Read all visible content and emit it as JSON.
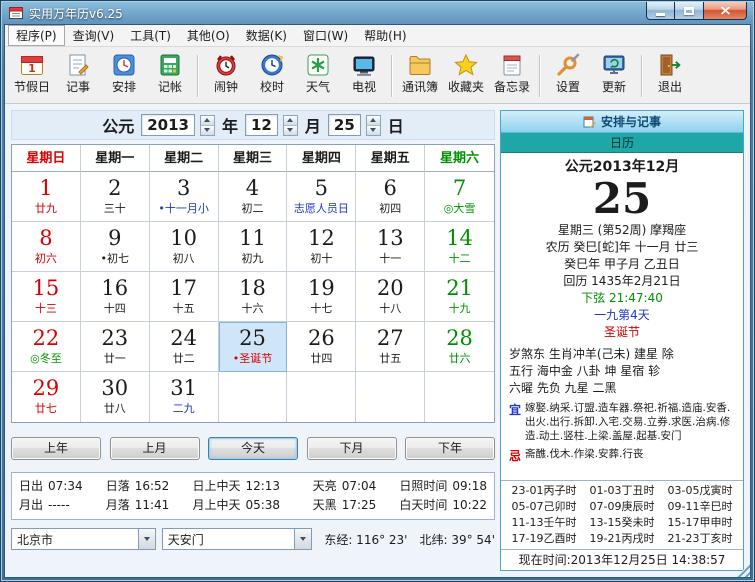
{
  "window": {
    "title": "实用万年历v6.25"
  },
  "colors": {
    "red": "#d80000",
    "green": "#009100",
    "blue": "#2038c8",
    "black": "#1c1c1c",
    "selected_bg": "#cfe5f8",
    "header_cyan": "#8fd2ec",
    "tab_teal": "#1fa6a6"
  },
  "menu": {
    "items": [
      {
        "label": "程序(P)",
        "name": "menu-program"
      },
      {
        "label": "查询(V)",
        "name": "menu-query"
      },
      {
        "label": "工具(T)",
        "name": "menu-tools"
      },
      {
        "label": "其他(O)",
        "name": "menu-other"
      },
      {
        "label": "数据(K)",
        "name": "menu-data"
      },
      {
        "label": "窗口(W)",
        "name": "menu-window"
      },
      {
        "label": "帮助(H)",
        "name": "menu-help"
      }
    ]
  },
  "toolbar": {
    "items": [
      {
        "label": "节假日",
        "icon": "holiday-icon",
        "name": "holiday"
      },
      {
        "label": "记事",
        "icon": "notes-icon",
        "name": "notes"
      },
      {
        "label": "安排",
        "icon": "schedule-icon",
        "name": "schedule"
      },
      {
        "label": "记帐",
        "icon": "accounting-icon",
        "name": "accounting",
        "separator_after": true
      },
      {
        "label": "闹钟",
        "icon": "alarm-icon",
        "name": "alarm"
      },
      {
        "label": "校时",
        "icon": "time-sync-icon",
        "name": "time-sync"
      },
      {
        "label": "天气",
        "icon": "weather-icon",
        "name": "weather"
      },
      {
        "label": "电视",
        "icon": "tv-icon",
        "name": "tv",
        "separator_after": true
      },
      {
        "label": "通讯簿",
        "icon": "contacts-icon",
        "name": "contacts"
      },
      {
        "label": "收藏夹",
        "icon": "favorites-icon",
        "name": "favorites"
      },
      {
        "label": "备忘录",
        "icon": "memo-icon",
        "name": "memo",
        "separator_after": true
      },
      {
        "label": "设置",
        "icon": "settings-icon",
        "name": "settings"
      },
      {
        "label": "更新",
        "icon": "update-icon",
        "name": "update",
        "separator_after": true
      },
      {
        "label": "退出",
        "icon": "exit-icon",
        "name": "exit"
      }
    ]
  },
  "date_selector": {
    "era": "公元",
    "year": "2013",
    "unit_year": "年",
    "month": "12",
    "unit_month": "月",
    "day": "25",
    "unit_day": "日"
  },
  "calendar": {
    "weekdays": [
      {
        "label": "星期日",
        "color": "red"
      },
      {
        "label": "星期一",
        "color": "black"
      },
      {
        "label": "星期二",
        "color": "black"
      },
      {
        "label": "星期三",
        "color": "black"
      },
      {
        "label": "星期四",
        "color": "black"
      },
      {
        "label": "星期五",
        "color": "black"
      },
      {
        "label": "星期六",
        "color": "green"
      }
    ],
    "cells": [
      {
        "day": "1",
        "note": "廿九",
        "day_color": "red",
        "note_color": "red"
      },
      {
        "day": "2",
        "note": "三十",
        "day_color": "black",
        "note_color": "black"
      },
      {
        "day": "3",
        "note": "•十一月小",
        "day_color": "black",
        "note_color": "blue"
      },
      {
        "day": "4",
        "note": "初二",
        "day_color": "black",
        "note_color": "black"
      },
      {
        "day": "5",
        "note": "志愿人员日",
        "day_color": "black",
        "note_color": "blue"
      },
      {
        "day": "6",
        "note": "初四",
        "day_color": "black",
        "note_color": "black"
      },
      {
        "day": "7",
        "note": "◎大雪",
        "day_color": "green",
        "note_color": "green"
      },
      {
        "day": "8",
        "note": "初六",
        "day_color": "red",
        "note_color": "red"
      },
      {
        "day": "9",
        "note": "•初七",
        "day_color": "black",
        "note_color": "black"
      },
      {
        "day": "10",
        "note": "初八",
        "day_color": "black",
        "note_color": "black"
      },
      {
        "day": "11",
        "note": "初九",
        "day_color": "black",
        "note_color": "black"
      },
      {
        "day": "12",
        "note": "初十",
        "day_color": "black",
        "note_color": "black"
      },
      {
        "day": "13",
        "note": "十一",
        "day_color": "black",
        "note_color": "black"
      },
      {
        "day": "14",
        "note": "十二",
        "day_color": "green",
        "note_color": "green"
      },
      {
        "day": "15",
        "note": "十三",
        "day_color": "red",
        "note_color": "red"
      },
      {
        "day": "16",
        "note": "十四",
        "day_color": "black",
        "note_color": "black"
      },
      {
        "day": "17",
        "note": "十五",
        "day_color": "black",
        "note_color": "black"
      },
      {
        "day": "18",
        "note": "十六",
        "day_color": "black",
        "note_color": "black"
      },
      {
        "day": "19",
        "note": "十七",
        "day_color": "black",
        "note_color": "black"
      },
      {
        "day": "20",
        "note": "十八",
        "day_color": "black",
        "note_color": "black"
      },
      {
        "day": "21",
        "note": "十九",
        "day_color": "green",
        "note_color": "green"
      },
      {
        "day": "22",
        "note": "◎冬至",
        "day_color": "red",
        "note_color": "green"
      },
      {
        "day": "23",
        "note": "廿一",
        "day_color": "black",
        "note_color": "black"
      },
      {
        "day": "24",
        "note": "廿二",
        "day_color": "black",
        "note_color": "black"
      },
      {
        "day": "25",
        "note": "•圣诞节",
        "day_color": "black",
        "note_color": "red",
        "selected": true
      },
      {
        "day": "26",
        "note": "廿四",
        "day_color": "black",
        "note_color": "black"
      },
      {
        "day": "27",
        "note": "廿五",
        "day_color": "black",
        "note_color": "black"
      },
      {
        "day": "28",
        "note": "廿六",
        "day_color": "green",
        "note_color": "green"
      },
      {
        "day": "29",
        "note": "廿七",
        "day_color": "red",
        "note_color": "red"
      },
      {
        "day": "30",
        "note": "廿八",
        "day_color": "black",
        "note_color": "black"
      },
      {
        "day": "31",
        "note": "二九",
        "day_color": "black",
        "note_color": "blue"
      },
      {
        "day": "",
        "note": ""
      },
      {
        "day": "",
        "note": ""
      },
      {
        "day": "",
        "note": ""
      },
      {
        "day": "",
        "note": ""
      }
    ]
  },
  "nav": {
    "buttons": [
      {
        "label": "上年",
        "name": "prev-year-button"
      },
      {
        "label": "上月",
        "name": "prev-month-button"
      },
      {
        "label": "今天",
        "name": "today-button",
        "default": true
      },
      {
        "label": "下月",
        "name": "next-month-button"
      },
      {
        "label": "下年",
        "name": "next-year-button"
      }
    ]
  },
  "sun_moon": {
    "rows": [
      [
        {
          "label": "日出",
          "value": "07:34"
        },
        {
          "label": "日落",
          "value": "16:52"
        },
        {
          "label": "日上中天",
          "value": "12:13"
        },
        {
          "label": "天亮",
          "value": "07:04"
        },
        {
          "label": "日照时间",
          "value": "09:18"
        }
      ],
      [
        {
          "label": "月出",
          "value": "-----"
        },
        {
          "label": "月落",
          "value": "11:41"
        },
        {
          "label": "月上中天",
          "value": "05:38"
        },
        {
          "label": "天黑",
          "value": "17:25"
        },
        {
          "label": "白天时间",
          "value": "10:22"
        }
      ]
    ]
  },
  "location": {
    "city": "北京市",
    "place": "天安门",
    "longitude": "东经: 116° 23'",
    "latitude": "北纬: 39° 54'"
  },
  "right_panel": {
    "header": "安排与记事",
    "tab": "日历",
    "month_title": "公元2013年12月",
    "big_day": "25",
    "week_line": "星期三 (第52周) 摩羯座",
    "lunar_line": "农历 癸巳[蛇]年 十一月 廿三",
    "ganzhi_line": "癸巳年 甲子月 乙丑日",
    "hijri_line": "回历 1435年2月21日",
    "moon_phase": "下弦 21:47:40",
    "nine_days": "一九第4天",
    "festival": "圣诞节",
    "info_lines": [
      "岁煞东 生肖冲羊(己未) 建星 除",
      "五行 海中金 八卦 坤 星宿 轸",
      "六曜 先负 九星 二黑"
    ],
    "yi_label": "宜",
    "yi_text": "嫁娶.纳采.订盟.造车器.祭祀.祈福.造庙.安香.出火.出行.拆卸.入宅.交易.立券.求医.治病.修造.动土.竖柱.上梁.盖屋.起基.安门",
    "ji_label": "忌",
    "ji_text": "斋醮.伐木.作梁.安葬.行丧",
    "hours": [
      "23-01丙子时",
      "01-03丁丑时",
      "03-05戊寅时",
      "05-07己卯时",
      "07-09庚辰时",
      "09-11辛巳时",
      "11-13壬午时",
      "13-15癸未时",
      "15-17甲申时",
      "17-19乙酉时",
      "19-21丙戌时",
      "21-23丁亥时"
    ],
    "now_line": "现在时间:2013年12月25日 14:38:57"
  }
}
